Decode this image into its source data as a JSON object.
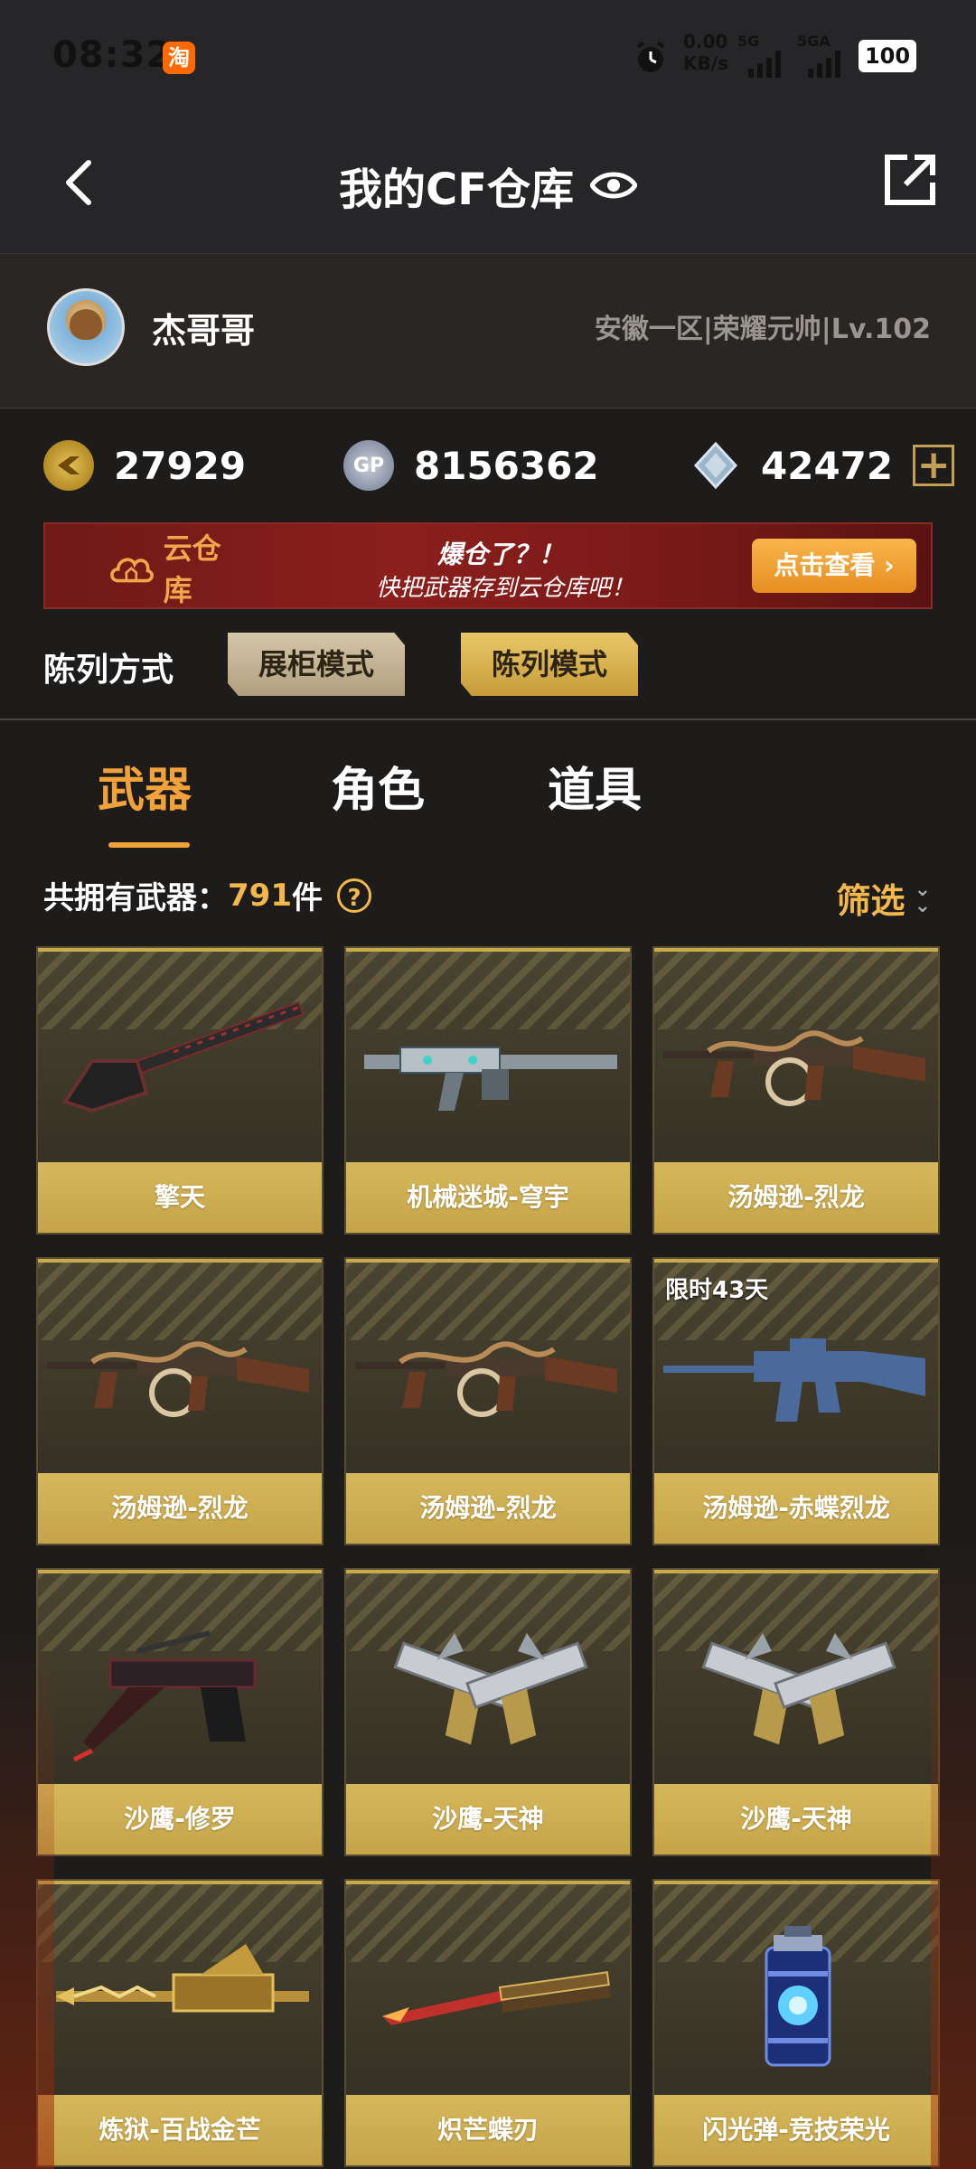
{
  "status_bar": {
    "time": "08:32",
    "app_icon": "淘",
    "speed_top": "0.00",
    "speed_bottom": "KB/s",
    "sim1": "5G",
    "sim2": "5GA",
    "battery": "100"
  },
  "header": {
    "title": "我的CF仓库"
  },
  "profile": {
    "username": "杰哥哥",
    "server": "安徽一区|荣耀元帅|Lv.102"
  },
  "currency": {
    "cf_points": "27929",
    "gp": "8156362",
    "gp_icon_text": "GP",
    "diamonds": "42472",
    "plus": "+"
  },
  "banner": {
    "label": "云仓库",
    "line1": "爆仓了？！",
    "line2": "快把武器存到云仓库吧！",
    "button": "点击查看 ›"
  },
  "display_mode": {
    "label": "陈列方式",
    "options": [
      "展柜模式",
      "陈列模式"
    ],
    "selected": "陈列模式"
  },
  "tabs": [
    {
      "label": "武器",
      "active": true
    },
    {
      "label": "角色",
      "active": false
    },
    {
      "label": "道具",
      "active": false
    }
  ],
  "summary": {
    "prefix": "共拥有武器：",
    "count": "791",
    "suffix": "件",
    "help": "?",
    "filter": "筛选",
    "filter_chevron": "⌄"
  },
  "items": [
    {
      "name": "擎天",
      "art": "shovel-icon",
      "badge": ""
    },
    {
      "name": "机械迷城-穹宇",
      "art": "assault-rifle-icon",
      "badge": ""
    },
    {
      "name": "汤姆逊-烈龙",
      "art": "tommy-gun-icon",
      "badge": ""
    },
    {
      "name": "汤姆逊-烈龙",
      "art": "tommy-gun-icon",
      "badge": ""
    },
    {
      "name": "汤姆逊-烈龙",
      "art": "tommy-gun-icon",
      "badge": ""
    },
    {
      "name": "汤姆逊-赤蝶烈龙",
      "art": "rifle-silhouette-icon",
      "badge": "限时43天"
    },
    {
      "name": "沙鹰-修罗",
      "art": "pistol-icon",
      "badge": ""
    },
    {
      "name": "沙鹰-天神",
      "art": "dual-pistols-icon",
      "badge": ""
    },
    {
      "name": "沙鹰-天神",
      "art": "dual-pistols-icon",
      "badge": ""
    },
    {
      "name": "炼狱-百战金芒",
      "art": "golden-rifle-icon",
      "badge": ""
    },
    {
      "name": "炽芒蝶刃",
      "art": "butterfly-knife-icon",
      "badge": ""
    },
    {
      "name": "闪光弹-竞技荣光",
      "art": "flashbang-icon",
      "badge": ""
    }
  ],
  "colors": {
    "accent": "#f2a23b",
    "card_name_bg": "#c5a44a",
    "background": "#1d1c1b"
  }
}
